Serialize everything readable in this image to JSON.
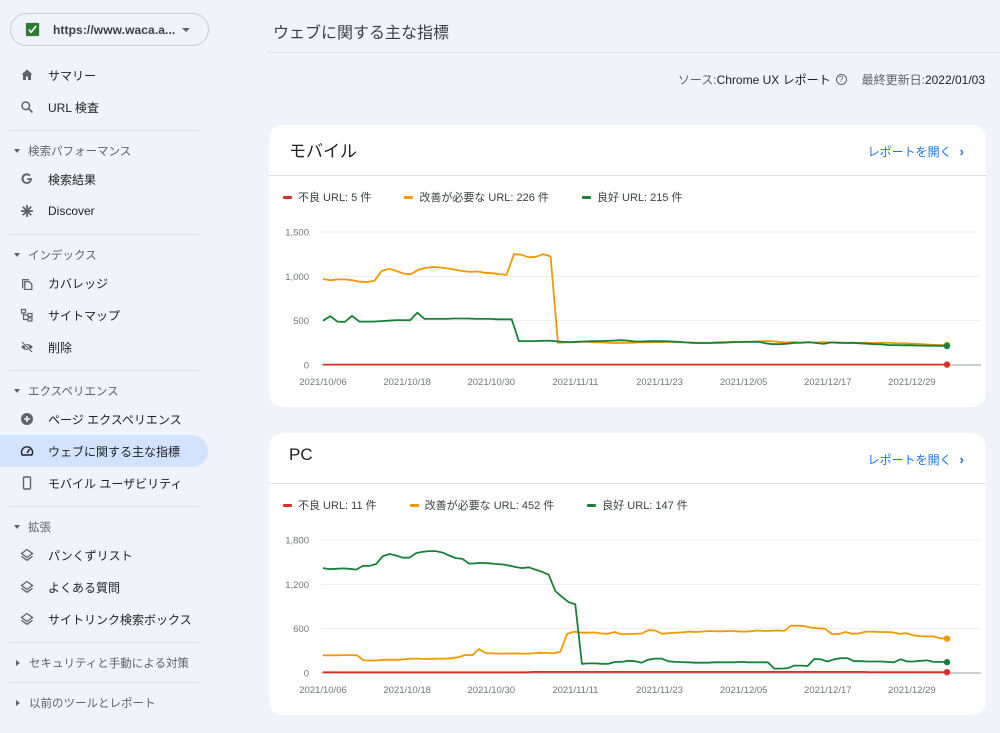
{
  "property": {
    "url": "https://www.waca.a...",
    "favicon_color": "#2e7d32"
  },
  "sidebar": {
    "top_items": [
      {
        "label": "サマリー",
        "icon": "home-icon"
      },
      {
        "label": "URL 検査",
        "icon": "search-icon"
      }
    ],
    "sections": [
      {
        "title": "検索パフォーマンス",
        "expanded": true,
        "items": [
          {
            "label": "検索結果",
            "icon": "google-g-icon"
          },
          {
            "label": "Discover",
            "icon": "asterisk-icon"
          }
        ]
      },
      {
        "title": "インデックス",
        "expanded": true,
        "items": [
          {
            "label": "カバレッジ",
            "icon": "copy-icon"
          },
          {
            "label": "サイトマップ",
            "icon": "sitemap-icon"
          },
          {
            "label": "削除",
            "icon": "eye-off-icon"
          }
        ]
      },
      {
        "title": "エクスペリエンス",
        "expanded": true,
        "items": [
          {
            "label": "ページ エクスペリエンス",
            "icon": "plus-circle-icon"
          },
          {
            "label": "ウェブに関する主な指標",
            "icon": "gauge-icon",
            "active": true
          },
          {
            "label": "モバイル ユーザビリティ",
            "icon": "phone-icon"
          }
        ]
      },
      {
        "title": "拡張",
        "expanded": true,
        "items": [
          {
            "label": "パンくずリスト",
            "icon": "layers-icon"
          },
          {
            "label": "よくある質問",
            "icon": "layers-icon"
          },
          {
            "label": "サイトリンク検索ボックス",
            "icon": "layers-icon"
          }
        ]
      },
      {
        "title": "セキュリティと手動による対策",
        "expanded": false,
        "items": []
      },
      {
        "title": "以前のツールとレポート",
        "expanded": false,
        "items": []
      }
    ]
  },
  "header": {
    "title": "ウェブに関する主な指標",
    "source_label": "ソース: ",
    "source_value": "Chrome UX レポート",
    "updated_label": "最終更新日: ",
    "updated_value": "2022/01/03"
  },
  "colors": {
    "poor": "#d93025",
    "needs_improvement": "#f29900",
    "good": "#188038"
  },
  "cards": [
    {
      "title": "モバイル",
      "open_report": "レポートを開く",
      "legend": [
        {
          "label": "不良 URL: 5 件",
          "color": "#d93025"
        },
        {
          "label": "改善が必要な URL: 226 件",
          "color": "#f29900"
        },
        {
          "label": "良好 URL: 215 件",
          "color": "#188038"
        }
      ]
    },
    {
      "title": "PC",
      "open_report": "レポートを開く",
      "legend": [
        {
          "label": "不良 URL: 11 件",
          "color": "#d93025"
        },
        {
          "label": "改善が必要な URL: 452 件",
          "color": "#f29900"
        },
        {
          "label": "良好 URL: 147 件",
          "color": "#188038"
        }
      ]
    }
  ],
  "chart_data": [
    {
      "type": "line",
      "title": "モバイル",
      "x_ticks": [
        "2021/10/06",
        "2021/10/18",
        "2021/10/30",
        "2021/11/11",
        "2021/11/23",
        "2021/12/05",
        "2021/12/17",
        "2021/12/29"
      ],
      "x_range": [
        "2021/10/06",
        "2022/01/03"
      ],
      "y_ticks": [
        0,
        500,
        1000,
        1500
      ],
      "ylim": [
        0,
        1500
      ],
      "grid": true,
      "legend_position": "top-left",
      "series": [
        {
          "name": "不良 URL",
          "color": "#d93025",
          "values": [
            5,
            5,
            5,
            5,
            5,
            5,
            5,
            5,
            5,
            5,
            5,
            5,
            5,
            5,
            5,
            5,
            5,
            5,
            5,
            5,
            5,
            5,
            5,
            5,
            5,
            5,
            5,
            5,
            5,
            5,
            5,
            5,
            5,
            5,
            5,
            5,
            5,
            5,
            5,
            5,
            5,
            5,
            5,
            5,
            5,
            5,
            5,
            5,
            5,
            5,
            5,
            5,
            5,
            5,
            5,
            5,
            5,
            5,
            5,
            5,
            5,
            5,
            5,
            5,
            5,
            5,
            5,
            5,
            5,
            5,
            5,
            5,
            5,
            5,
            5,
            5,
            5,
            5,
            5,
            5,
            5,
            5,
            5,
            5,
            5,
            5,
            5,
            5,
            5,
            5
          ]
        },
        {
          "name": "改善が必要な URL",
          "color": "#f29900",
          "values": [
            970,
            955,
            965,
            965,
            955,
            940,
            935,
            950,
            1060,
            1085,
            1060,
            1030,
            1025,
            1075,
            1095,
            1105,
            1100,
            1090,
            1075,
            1060,
            1050,
            1055,
            1040,
            1035,
            1025,
            1015,
            1250,
            1245,
            1215,
            1220,
            1250,
            1225,
            250,
            255,
            255,
            260,
            260,
            255,
            255,
            250,
            248,
            250,
            250,
            255,
            255,
            258,
            258,
            260,
            258,
            255,
            252,
            250,
            250,
            252,
            258,
            258,
            262,
            262,
            262,
            265,
            270,
            270,
            262,
            255,
            258,
            252,
            255,
            252,
            258,
            255,
            255,
            252,
            250,
            250,
            250,
            248,
            250,
            250,
            245,
            245,
            240,
            238,
            232,
            228,
            226,
            226
          ]
        },
        {
          "name": "良好 URL",
          "color": "#188038",
          "values": [
            500,
            550,
            490,
            485,
            555,
            490,
            490,
            490,
            495,
            500,
            505,
            505,
            505,
            590,
            520,
            520,
            520,
            520,
            525,
            525,
            525,
            520,
            520,
            520,
            515,
            515,
            515,
            270,
            270,
            270,
            272,
            275,
            270,
            262,
            258,
            262,
            265,
            268,
            270,
            272,
            275,
            280,
            275,
            265,
            265,
            268,
            270,
            268,
            265,
            262,
            255,
            250,
            248,
            248,
            250,
            252,
            255,
            258,
            260,
            260,
            262,
            245,
            235,
            235,
            240,
            250,
            252,
            258,
            248,
            238,
            255,
            250,
            248,
            250,
            245,
            240,
            235,
            232,
            225,
            225,
            222,
            222,
            220,
            218,
            218,
            216,
            215
          ]
        }
      ]
    },
    {
      "type": "line",
      "title": "PC",
      "x_ticks": [
        "2021/10/06",
        "2021/10/18",
        "2021/10/30",
        "2021/11/11",
        "2021/11/23",
        "2021/12/05",
        "2021/12/17",
        "2021/12/29"
      ],
      "x_range": [
        "2021/10/06",
        "2022/01/03"
      ],
      "y_ticks": [
        0,
        600,
        1200,
        1800
      ],
      "ylim": [
        0,
        1800
      ],
      "grid": true,
      "legend_position": "top-left",
      "series": [
        {
          "name": "不良 URL",
          "color": "#d93025",
          "values": [
            10,
            10,
            10,
            10,
            10,
            10,
            10,
            10,
            10,
            10,
            10,
            10,
            10,
            10,
            10,
            10,
            10,
            10,
            10,
            10,
            10,
            10,
            10,
            10,
            10,
            10,
            10,
            10,
            10,
            10,
            15,
            15,
            15,
            15,
            15,
            15,
            15,
            15,
            15,
            15,
            15,
            15,
            15,
            15,
            15,
            15,
            15,
            15,
            15,
            15,
            15,
            15,
            15,
            15,
            15,
            15,
            15,
            15,
            15,
            15,
            15,
            15,
            15,
            15,
            15,
            15,
            15,
            15,
            15,
            15,
            15,
            15,
            15,
            15,
            15,
            15,
            15,
            15,
            12,
            12,
            12,
            12,
            12,
            12,
            12,
            12,
            11,
            11,
            11,
            11
          ]
        },
        {
          "name": "改善が必要な URL",
          "color": "#f29900",
          "values": [
            240,
            238,
            240,
            242,
            242,
            240,
            170,
            168,
            170,
            178,
            180,
            178,
            185,
            195,
            195,
            190,
            192,
            195,
            195,
            200,
            215,
            245,
            240,
            325,
            270,
            265,
            262,
            262,
            265,
            262,
            262,
            265,
            275,
            272,
            265,
            290,
            530,
            560,
            545,
            545,
            550,
            535,
            530,
            555,
            525,
            528,
            530,
            535,
            580,
            575,
            530,
            540,
            545,
            550,
            560,
            555,
            562,
            568,
            565,
            565,
            570,
            565,
            560,
            565,
            575,
            570,
            570,
            575,
            570,
            640,
            640,
            635,
            615,
            605,
            600,
            530,
            525,
            555,
            530,
            535,
            560,
            560,
            555,
            555,
            550,
            530,
            540,
            510,
            500,
            495,
            495,
            470,
            465
          ]
        },
        {
          "name": "良好 URL",
          "color": "#188038",
          "values": [
            1420,
            1405,
            1410,
            1415,
            1410,
            1400,
            1450,
            1450,
            1475,
            1580,
            1610,
            1590,
            1560,
            1560,
            1620,
            1640,
            1650,
            1650,
            1630,
            1590,
            1555,
            1545,
            1480,
            1485,
            1490,
            1485,
            1475,
            1470,
            1455,
            1435,
            1420,
            1430,
            1400,
            1370,
            1330,
            1110,
            1030,
            960,
            930,
            125,
            130,
            130,
            125,
            125,
            150,
            150,
            165,
            160,
            140,
            180,
            195,
            195,
            160,
            150,
            148,
            145,
            140,
            140,
            140,
            145,
            145,
            145,
            145,
            150,
            145,
            145,
            145,
            145,
            60,
            60,
            65,
            100,
            100,
            95,
            190,
            185,
            155,
            185,
            200,
            200,
            160,
            160,
            155,
            155,
            155,
            150,
            145,
            185,
            155,
            155,
            165,
            170,
            150,
            150,
            147
          ]
        }
      ]
    }
  ]
}
